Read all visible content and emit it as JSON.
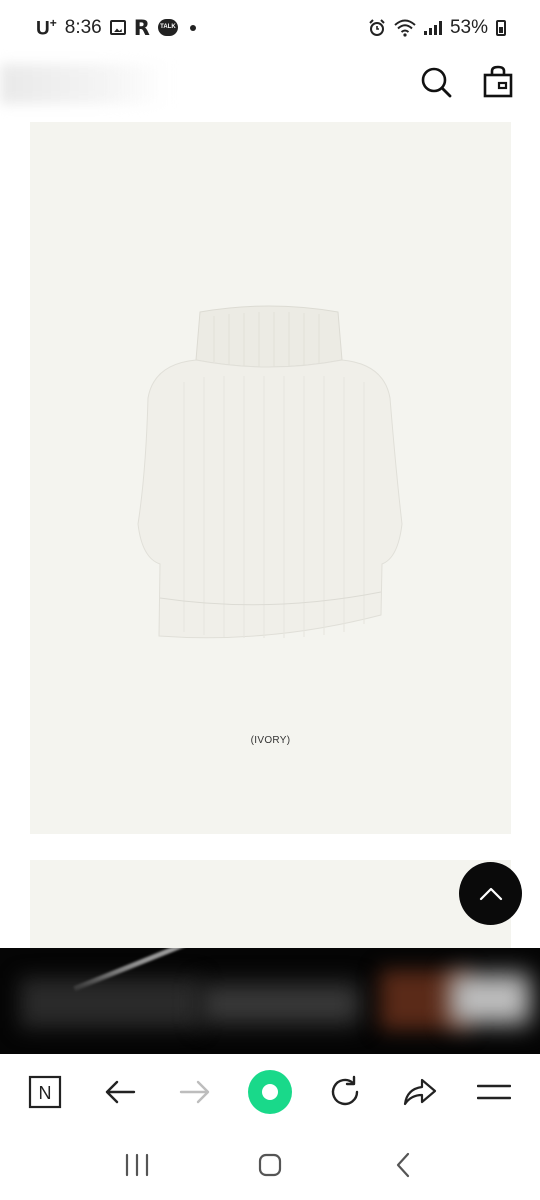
{
  "status_bar": {
    "carrier": "U",
    "carrier_sup": "+",
    "time": "8:36",
    "talk_badge": "TALK",
    "battery": "53%"
  },
  "header": {
    "icons": [
      "search-icon",
      "shopping-bag-icon"
    ]
  },
  "product": {
    "variant_label": "(IVORY)",
    "image_background": "#f4f4ef",
    "item": "sleeveless turtleneck knit vest"
  },
  "colors": {
    "brand_green": "#19d98a",
    "scroll_top_bg": "#0a0a0a",
    "banner_bg": "#050505"
  },
  "browser_toolbar": {
    "buttons": [
      "n-logo-icon",
      "back-arrow-icon",
      "forward-arrow-icon",
      "home-icon",
      "refresh-icon",
      "share-icon",
      "menu-icon"
    ],
    "n_label": "N"
  },
  "android_nav": {
    "buttons": [
      "recent-apps-icon",
      "home-icon",
      "back-icon"
    ]
  }
}
